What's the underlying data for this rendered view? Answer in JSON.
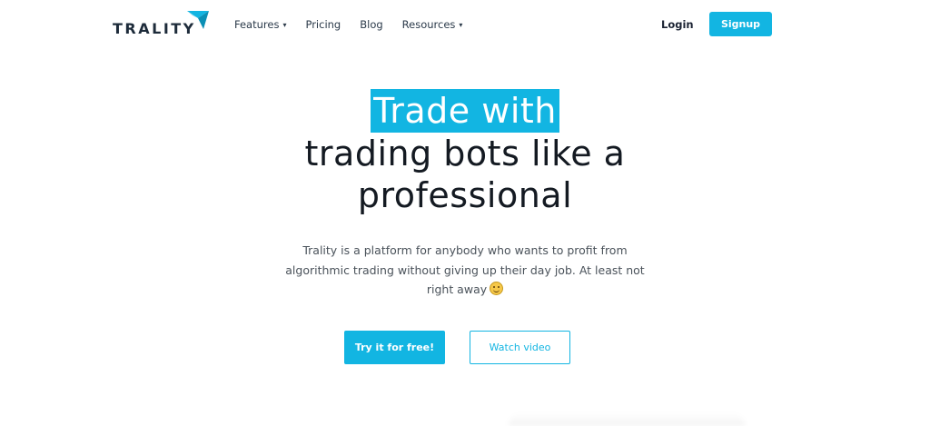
{
  "brand": {
    "name": "TRALITY",
    "accent_color": "#12b5e2",
    "logo_icon": "trality-mark-icon"
  },
  "nav": {
    "items": [
      {
        "label": "Features",
        "has_dropdown": true
      },
      {
        "label": "Pricing",
        "has_dropdown": false
      },
      {
        "label": "Blog",
        "has_dropdown": false
      },
      {
        "label": "Resources",
        "has_dropdown": true
      }
    ],
    "caret": "▾",
    "login_label": "Login",
    "signup_label": "Signup"
  },
  "hero": {
    "title_highlight": "Trade with",
    "title_line2": "trading bots like a",
    "title_line3": "professional",
    "description": "Trality is a platform for anybody who wants to profit from algorithmic trading without giving up their day job. At least not right away",
    "emoji_icon": "winking-face-icon",
    "cta_primary": "Try it for free!",
    "cta_secondary": "Watch video"
  }
}
